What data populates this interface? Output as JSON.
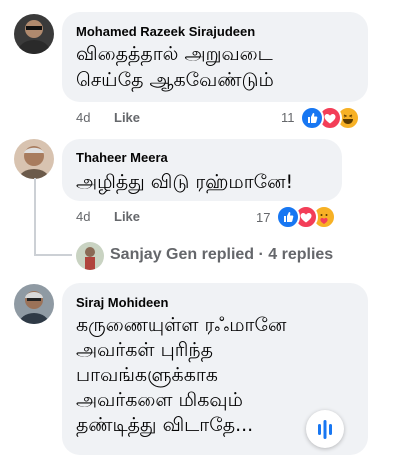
{
  "comments": [
    {
      "author": "Mohamed Razeek Sirajudeen",
      "text_lines": [
        "விதைத்தால் அறுவடை",
        "செய்தே ஆகவேண்டும்"
      ],
      "time": "4d",
      "like_label": "Like",
      "reaction_count": "11",
      "reactions": [
        "like-reaction-icon",
        "love-reaction-icon",
        "haha-reaction-icon"
      ]
    },
    {
      "author": "Thaheer Meera",
      "text_lines": [
        "அழித்து விடு ரஹ்மானே!"
      ],
      "time": "4d",
      "like_label": "Like",
      "reaction_count": "17",
      "reactions": [
        "like-reaction-icon",
        "love-reaction-icon",
        "care-reaction-icon"
      ]
    },
    {
      "author": "Siraj Mohideen",
      "text_lines": [
        "கருணையுள்ள ரஃமானே",
        "அவர்கள் புரிந்த",
        "பாவங்களுக்காக",
        "அவர்களை மிகவும்",
        "தண்டித்து விடாதே..."
      ]
    }
  ],
  "replies": {
    "label": "Sanjay Gen replied · 4 replies"
  },
  "colors": {
    "bubble": "#f0f2f5",
    "meta": "#65676b",
    "like_blue": "#1877f2",
    "love_red": "#f33e58",
    "haha_yellow": "#f7b125"
  },
  "icons": {
    "fab": "voice-bars-icon"
  }
}
